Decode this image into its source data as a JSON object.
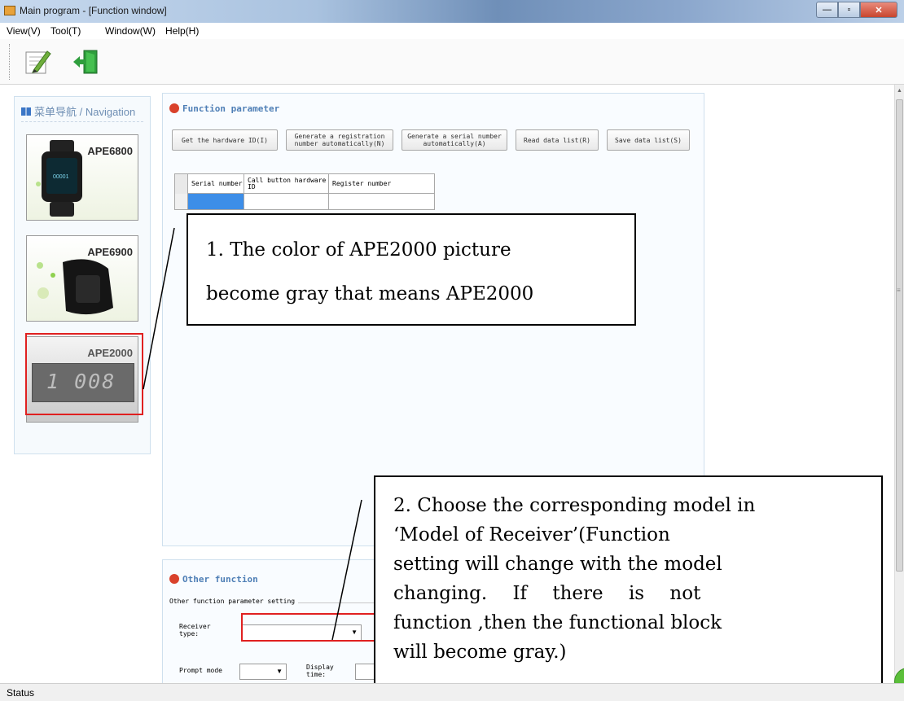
{
  "window": {
    "title": "Main program - [Function window]"
  },
  "menu": [
    "View(V)",
    "Tool(T)",
    "Window(W)",
    "Help(H)"
  ],
  "toolbar": {
    "buttons": [
      "notepad-pencil-icon",
      "exit-door-icon"
    ]
  },
  "navigation": {
    "title": "菜单导航 / Navigation",
    "items": [
      {
        "model": "APE6800",
        "screen_text": "00001"
      },
      {
        "model": "APE6900"
      },
      {
        "model": "APE2000",
        "display": "1 008",
        "state": "gray"
      }
    ]
  },
  "function_panel": {
    "title": "Function parameter",
    "buttons": [
      "Get the hardware ID(I)",
      "Generate a registration number automatically(N)",
      "Generate a serial number automatically(A)",
      "Read data list(R)",
      "Save data list(S)"
    ],
    "grid_headers": [
      "Serial number",
      "Call button hardware ID",
      "Register number"
    ]
  },
  "other_panel": {
    "title": "Other function",
    "group_label": "Other function parameter setting",
    "receiver_type_label": "Receiver type:",
    "receiver_type_value": "",
    "prompt_mode_label": "Prompt mode",
    "prompt_mode_value": "",
    "display_time_label": "Display time:"
  },
  "annotations": {
    "note1_line1": "1. The color of APE2000 picture",
    "note1_line2": "become gray that means APE2000",
    "note2_lines": [
      "2. Choose the corresponding model in",
      "‘Model of Receiver’(Function",
      "setting will change with the model",
      "changing. If there is not",
      "function ,then the functional block",
      "will become gray.)"
    ]
  },
  "status": "Status",
  "colors": {
    "highlight": "#e02020",
    "accent": "#4f7fb6",
    "title_dot": "#d9412b"
  }
}
